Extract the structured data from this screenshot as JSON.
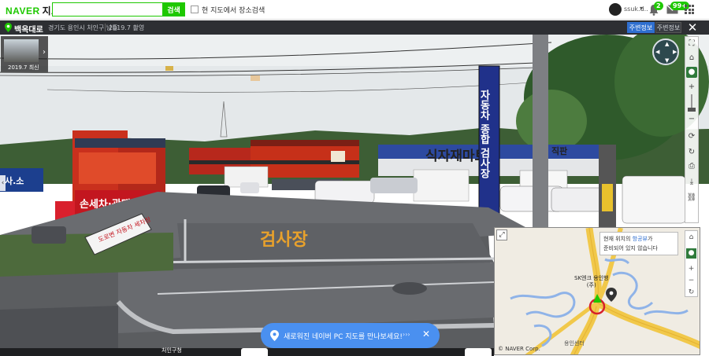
{
  "naver": {
    "logo": "NAVER",
    "service": "지도",
    "search_value": "",
    "search_placeholder": "",
    "search_button": "검색",
    "area_search_label": "현 지도에서 장소검색",
    "user_name": "ssuk.d..",
    "notification_count": "2",
    "mail_count": "99+"
  },
  "streetview": {
    "title": "백옥대로",
    "address": "경기도 용인시 처인구 남동",
    "date": "2019.7 촬영",
    "nearby_button": "주변정보",
    "info_button": "주변정보",
    "close": "✕",
    "timeline_label": "2019.7 최신"
  },
  "scene_signs": {
    "shop_left": "사.소",
    "carwash": "손세차·광택",
    "carwash_sign": "손세차",
    "standing_sign": "도로변 자동차 세차장",
    "road_marking": "검사장",
    "tall_banner": "자동차 종합 검사장",
    "mart": "식자재마트",
    "supermarket": "직판",
    "office": "사무실"
  },
  "minimap": {
    "tooltip_line1": "현재 위치의 ",
    "tooltip_highlight": "항공뷰",
    "tooltip_line1_end": "가",
    "tooltip_line2": "준비되어 있지 않습니다",
    "place_label": "SK엔크 용인행",
    "place_label2": "(주)",
    "town_label": "용인센터",
    "copyright": "© NAVER Corp."
  },
  "promo": {
    "text": "새로워진 네이버 PC 지도를 만나보세요!",
    "arrows": "›››",
    "close": "✕"
  },
  "bottom_label": "처인구청",
  "colors": {
    "naver_green": "#1ec800",
    "header_dark": "#2d2f33",
    "accent_blue": "#2f6fd0",
    "promo_blue": "#4a90f0"
  }
}
